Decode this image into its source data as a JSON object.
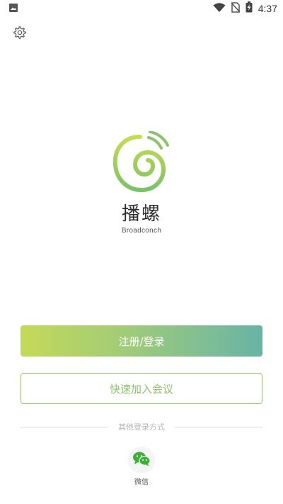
{
  "status_bar": {
    "time": "4:37",
    "icons": [
      "image-icon",
      "wifi-icon",
      "no-sim-icon",
      "battery-charging-icon"
    ]
  },
  "header": {
    "settings_icon": "gear-icon"
  },
  "brand": {
    "name": "播螺",
    "subtitle": "Broadconch"
  },
  "actions": {
    "register_login": "注册/登录",
    "quick_join": "快速加入会议"
  },
  "other_login": {
    "label": "其他登录方式",
    "wechat_label": "微信"
  },
  "colors": {
    "accent_green": "#8cc46a",
    "gradient_start": "#c4d957",
    "gradient_end": "#68b3a7"
  }
}
